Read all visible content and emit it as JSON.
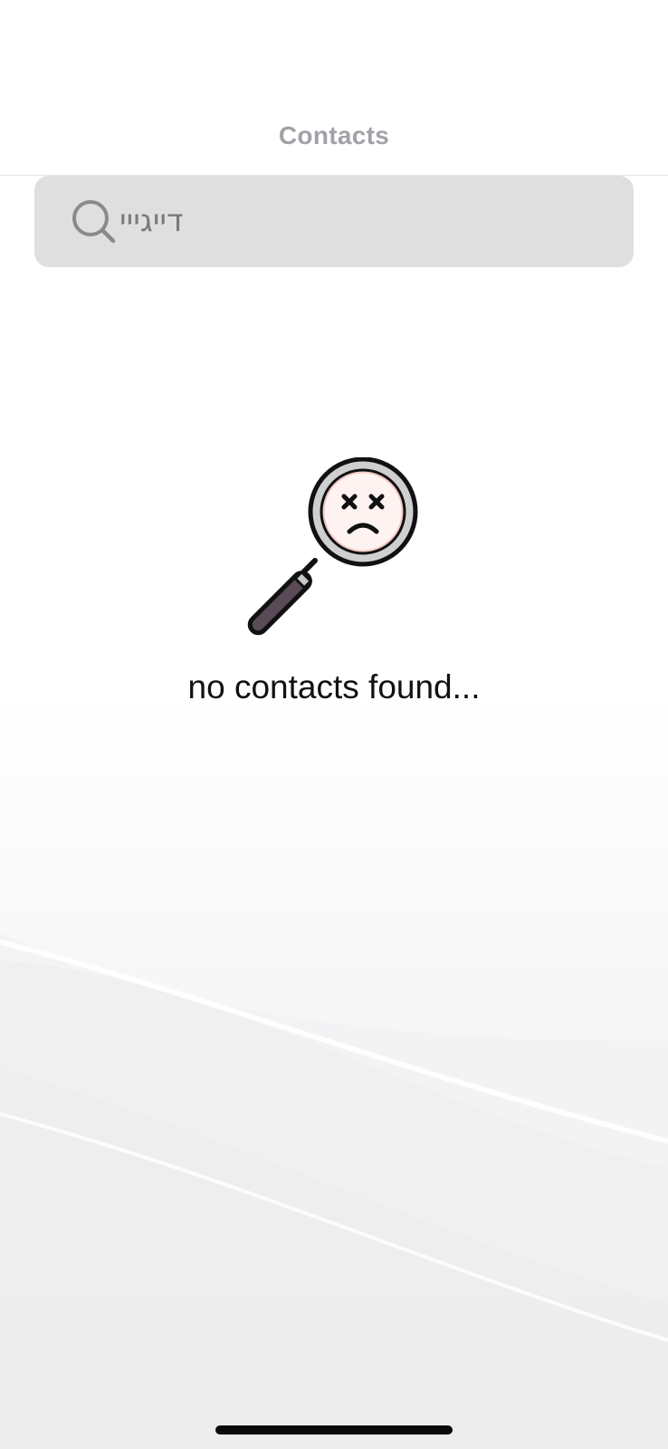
{
  "nav": {
    "title": "Contacts"
  },
  "search": {
    "value": "דייגייי",
    "icon": "search-icon"
  },
  "empty_state": {
    "icon": "sad-magnifier-icon",
    "message": "no contacts found..."
  },
  "colors": {
    "title": "#a1a2a8",
    "search_background": "#dfdfdf",
    "search_text": "#7a7a7c",
    "face_fill": "#fff3f2",
    "handle": "#5a4a55"
  }
}
